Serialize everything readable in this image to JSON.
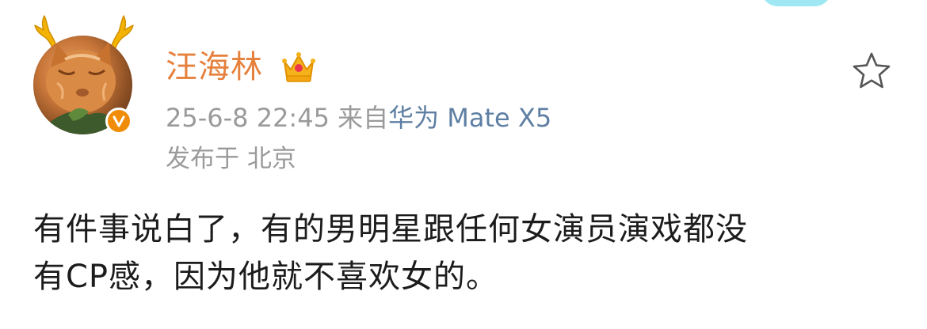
{
  "post": {
    "author": {
      "name": "汪海林",
      "avatar_icon": "cat-avatar",
      "verified_icon": "verified-v-badge-icon",
      "vip_icon": "crown-icon",
      "name_color": "#e6803d"
    },
    "meta": {
      "timestamp": "25-6-8 22:45",
      "source_prefix": "来自",
      "device": "华为 Mate X5",
      "device_color": "#5e7fa3",
      "location": "发布于 北京"
    },
    "favorite_icon": "star-outline-icon",
    "content": {
      "line1": "有件事说白了，有的男明星跟任何女演员演戏都没",
      "line2": "有CP感，因为他就不喜欢女的。"
    }
  }
}
